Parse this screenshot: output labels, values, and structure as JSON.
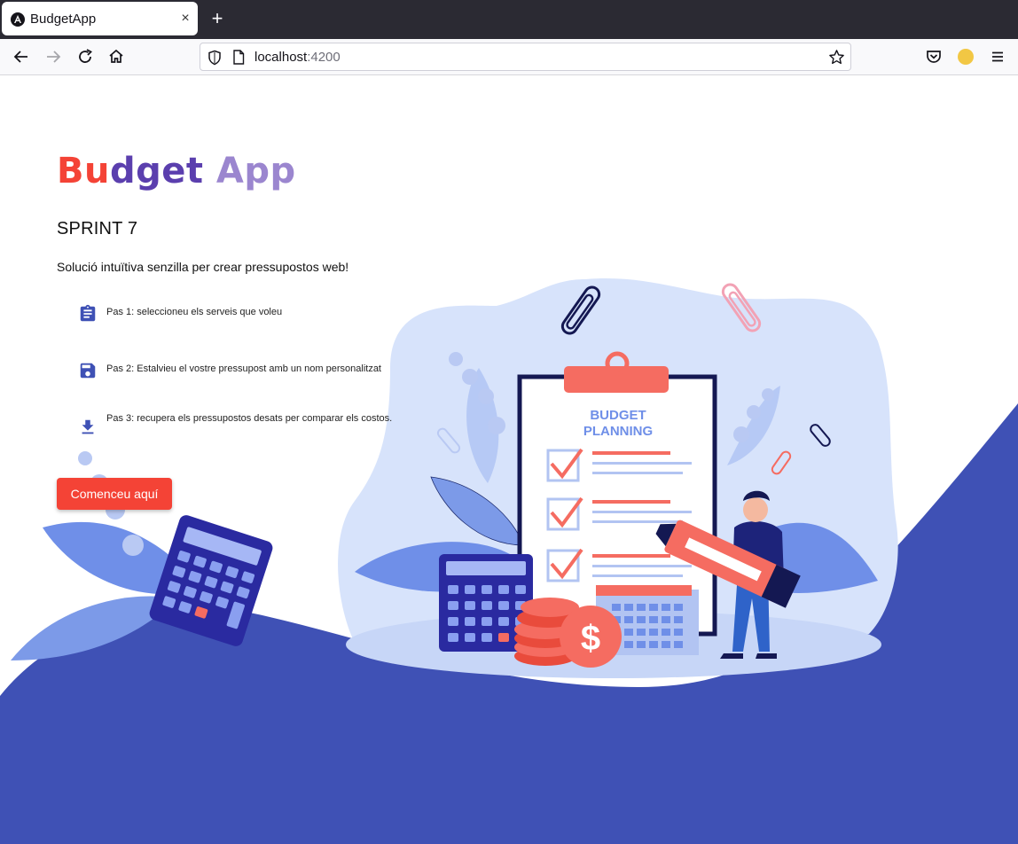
{
  "browser": {
    "tab_title": "BudgetApp",
    "tab_close": "×",
    "new_tab": "+",
    "url_host": "localhost",
    "url_port": ":4200"
  },
  "page": {
    "logo_text": [
      "Bu",
      "dget",
      " ",
      "App"
    ],
    "title": "SPRINT 7",
    "subtitle": "Solució intuïtiva senzilla per crear pressupostos web!",
    "steps": [
      {
        "icon": "clipboard-icon",
        "text": "Pas 1: seleccioneu els serveis que voleu"
      },
      {
        "icon": "save-icon",
        "text": "Pas 2: Estalvieu el vostre pressupost amb un nom personalitzat"
      },
      {
        "icon": "download-icon",
        "text": "Pas 3: recupera els pressupostos desats per comparar els costos."
      }
    ],
    "cta_label": "Comenceu aquí",
    "illustration": {
      "board_title_line1": "BUDGET",
      "board_title_line2": "PLANNING",
      "coin_symbol": "$"
    }
  },
  "colors": {
    "wave": "#3f51b5",
    "cta": "#f44336",
    "icon": "#3f51b5",
    "accent_red": "#f56c61"
  }
}
